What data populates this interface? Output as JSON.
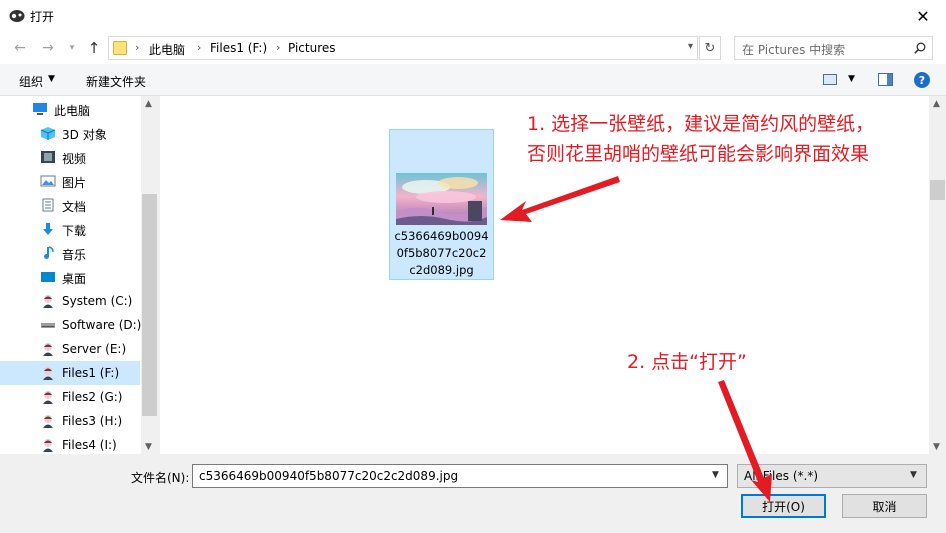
{
  "window": {
    "title": "打开",
    "close_glyph": "✕"
  },
  "address": {
    "crumbs": [
      "此电脑",
      "Files1 (F:)",
      "Pictures"
    ],
    "search_placeholder": "在 Pictures 中搜索"
  },
  "toolbar": {
    "organize": "组织",
    "new_folder": "新建文件夹",
    "help": "?"
  },
  "nav": {
    "items": [
      {
        "label": "此电脑",
        "icon": "pc-icon",
        "root": true,
        "selected": false
      },
      {
        "label": "3D 对象",
        "icon": "3d-objects-icon",
        "selected": false
      },
      {
        "label": "视频",
        "icon": "video-icon",
        "selected": false
      },
      {
        "label": "图片",
        "icon": "pictures-icon",
        "selected": false
      },
      {
        "label": "文档",
        "icon": "documents-icon",
        "selected": false
      },
      {
        "label": "下载",
        "icon": "download-icon",
        "selected": false
      },
      {
        "label": "音乐",
        "icon": "music-icon",
        "selected": false
      },
      {
        "label": "桌面",
        "icon": "desktop-icon",
        "selected": false
      },
      {
        "label": "System (C:)",
        "icon": "drive-avatar-icon",
        "selected": false
      },
      {
        "label": "Software (D:)",
        "icon": "drive-icon",
        "selected": false
      },
      {
        "label": "Server (E:)",
        "icon": "drive-avatar-icon",
        "selected": false
      },
      {
        "label": "Files1 (F:)",
        "icon": "drive-avatar-icon",
        "selected": true
      },
      {
        "label": "Files2 (G:)",
        "icon": "drive-avatar-icon",
        "selected": false
      },
      {
        "label": "Files3 (H:)",
        "icon": "drive-avatar-icon",
        "selected": false
      },
      {
        "label": "Files4 (I:)",
        "icon": "drive-avatar-icon",
        "selected": false
      }
    ]
  },
  "file": {
    "name_lines": [
      "c5366469b0094",
      "0f5b8077c20c2",
      "c2d089.jpg"
    ]
  },
  "annotations": {
    "step1_line1": "1. 选择一张壁纸，建议是简约风的壁纸，",
    "step1_line2": "否则花里胡哨的壁纸可能会影响界面效果",
    "step2": "2. 点击“打开”",
    "color": "#e31b23"
  },
  "bottom": {
    "filename_label": "文件名(N):",
    "filename_value": "c5366469b00940f5b8077c20c2c2d089.jpg",
    "filetype_value": "All Files (*.*)",
    "open_button": "打开(O)",
    "cancel_button": "取消"
  },
  "colors": {
    "selection": "#cce8ff",
    "selection_border": "#99d1ff",
    "accent": "#0078d7"
  }
}
